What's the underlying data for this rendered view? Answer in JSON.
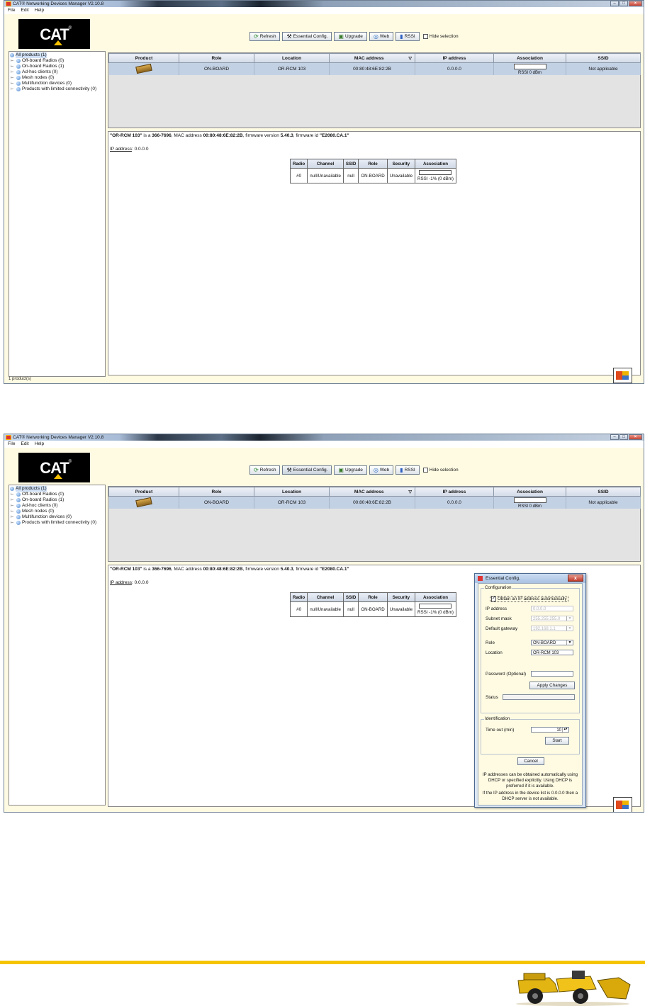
{
  "window": {
    "title": "CAT® Networking Devices Manager V2.10.8",
    "menu": [
      "File",
      "Edit",
      "Help"
    ]
  },
  "toolbar": {
    "refresh": "Refresh",
    "essential": "Essential Config.",
    "upgrade": "Upgrade",
    "web": "Web",
    "rssi": "RSSI",
    "hide_selection": "Hide selection"
  },
  "logo": {
    "text": "CAT",
    "mark": "®"
  },
  "tree": [
    "All products (1)",
    "Off-board Radios (0)",
    "On-board Radios (1)",
    "Ad-hoc clients (0)",
    "Mesh nodes (0)",
    "Multifunction devices (0)",
    "Products with limited connectivity (0)"
  ],
  "devices": {
    "headers": [
      "Product",
      "Role",
      "Location",
      "MAC address",
      "IP address",
      "Association",
      "SSID"
    ],
    "row": {
      "role": "ON-BOARD",
      "location": "OR-RCM 103",
      "mac": "00:80:48:6E:82:2B",
      "ip": "0.0.0.0",
      "assoc": "RSSI 0 dBm",
      "ssid": "Not applicable"
    }
  },
  "details": {
    "desc_name": "\"OR-RCM 103\"",
    "desc_mid1": " is a ",
    "desc_model": "366-7696",
    "desc_mid2": ", MAC address ",
    "desc_mac": "00:80:48:6E:82:2B",
    "desc_mid3": ", firmware version ",
    "desc_fw": "5.40.3",
    "desc_mid4": ", firmware id ",
    "desc_fwid": "\"E2080.CA.1\"",
    "ip_label": "IP address",
    "ip_value": ": 0.0.0.0",
    "radio_headers": [
      "Radio",
      "Channel",
      "SSID",
      "Role",
      "Security",
      "Association"
    ],
    "radio_row": [
      "#0",
      "null/Unavailable",
      "null",
      "ON-BOARD",
      "Unavailable",
      "RSSI -1% (0 dBm)"
    ]
  },
  "status": "1 product(s)",
  "dialog": {
    "title": "Essential Config.",
    "close": "x",
    "configuration": "Configuration",
    "obtain_auto": "Obtain an IP address automatically",
    "ip_label": "IP address",
    "ip_value": "0.0.0.0",
    "subnet_label": "Subnet mask",
    "subnet_value": "255.255.255.0",
    "gateway_label": "Default gateway",
    "gateway_value": "192.168.1.1",
    "role_label": "Role",
    "role_value": "ON-BOARD",
    "location_label": "Location",
    "location_value": "OR-RCM 103",
    "password_label": "Password (Optional)",
    "apply": "Apply Changes",
    "status_label": "Status",
    "identification": "Identification",
    "timeout_label": "Time out (min)",
    "timeout_value": "10",
    "start": "Start",
    "cancel": "Cancel",
    "info1": "IP addresses can be obtained automatically using DHCP or specified explicitly. Using DHCP is preferred if it is available.",
    "info2": "If the IP address in the device list is 0.0.0.0 then a DHCP server is not available."
  },
  "colors": {
    "accent": "#f5c400",
    "selection": "#c3d1e4",
    "background": "#fffbe3"
  }
}
